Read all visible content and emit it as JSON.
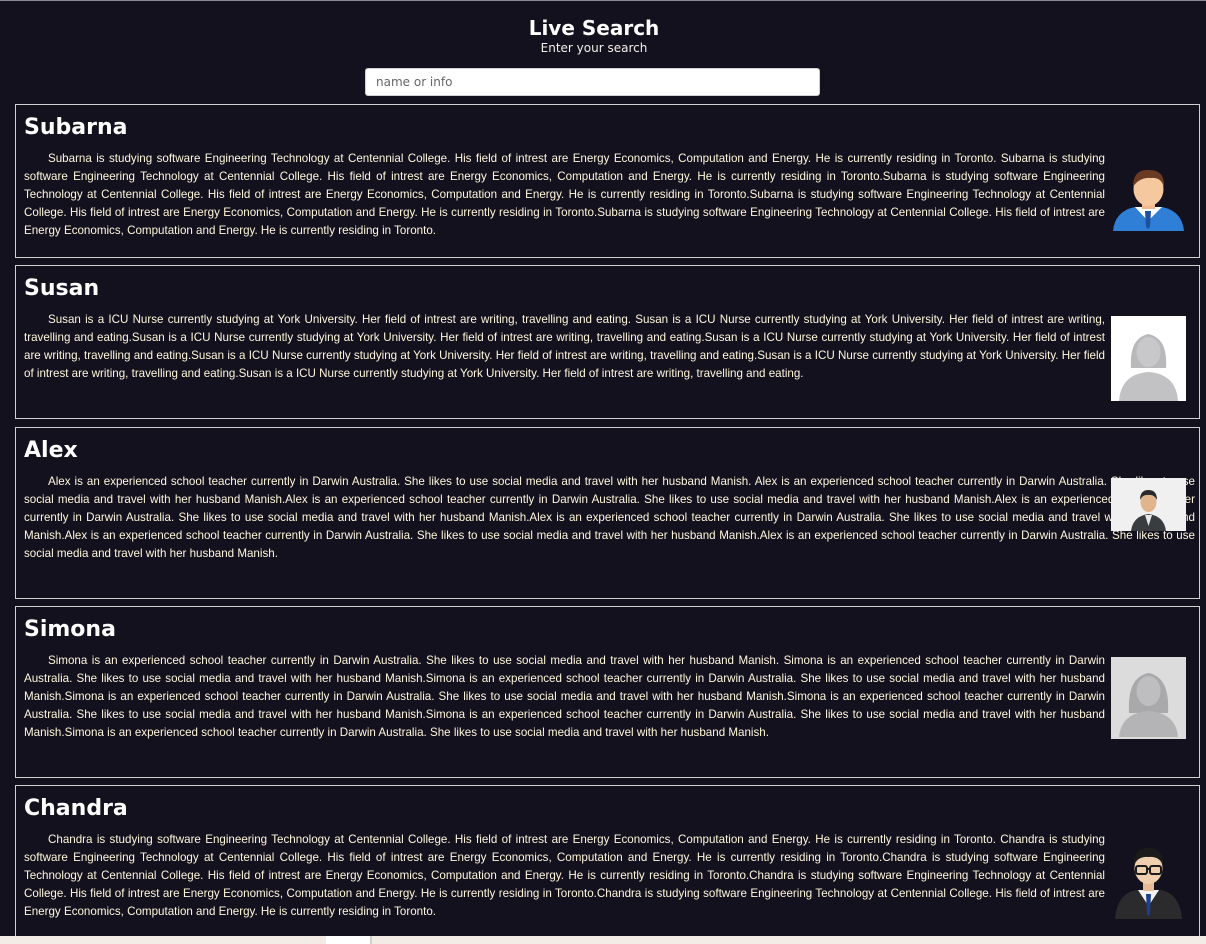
{
  "page": {
    "title": "Live Search",
    "subtitle": "Enter your search"
  },
  "search": {
    "placeholder": "name or info",
    "value": ""
  },
  "profiles": [
    {
      "name": "Subarna",
      "avatar": "male-business-avatar",
      "info": "Subarna is studying software Engineering Technology at Centennial College. His field of intrest are Energy Economics, Computation and Energy. He is currently residing in Toronto. Subarna is studying software Engineering Technology at Centennial College. His field of intrest are Energy Economics, Computation and Energy. He is currently residing in Toronto.Subarna is studying software Engineering Technology at Centennial College. His field of intrest are Energy Economics, Computation and Energy. He is currently residing in Toronto.Subarna is studying software Engineering Technology at Centennial College. His field of intrest are Energy Economics, Computation and Energy. He is currently residing in Toronto.Subarna is studying software Engineering Technology at Centennial College. His field of intrest are Energy Economics, Computation and Energy. He is currently residing in Toronto."
    },
    {
      "name": "Susan",
      "avatar": "female-placeholder-avatar",
      "info": "Susan is a ICU Nurse currently studying at York University. Her field of intrest are writing, travelling and eating. Susan is a ICU Nurse currently studying at York University. Her field of intrest are writing, travelling and eating.Susan is a ICU Nurse currently studying at York University. Her field of intrest are writing, travelling and eating.Susan is a ICU Nurse currently studying at York University. Her field of intrest are writing, travelling and eating.Susan is a ICU Nurse currently studying at York University. Her field of intrest are writing, travelling and eating.Susan is a ICU Nurse currently studying at York University. Her field of intrest are writing, travelling and eating.Susan is a ICU Nurse currently studying at York University. Her field of intrest are writing, travelling and eating."
    },
    {
      "name": "Alex",
      "avatar": "male-suit-avatar",
      "info": "Alex is an experienced school teacher currently in Darwin Australia. She likes to use social media and travel with her husband Manish. Alex is an experienced school teacher currently in Darwin Australia. She likes to use social media and travel with her husband Manish.Alex is an experienced school teacher currently in Darwin Australia. She likes to use social media and travel with her husband Manish.Alex is an experienced school teacher currently in Darwin Australia. She likes to use social media and travel with her husband Manish.Alex is an experienced school teacher currently in Darwin Australia. She likes to use social media and travel with her husband Manish.Alex is an experienced school teacher currently in Darwin Australia. She likes to use social media and travel with her husband Manish.Alex is an experienced school teacher currently in Darwin Australia. She likes to use social media and travel with her husband Manish."
    },
    {
      "name": "Simona",
      "avatar": "female-placeholder-avatar",
      "info": "Simona is an experienced school teacher currently in Darwin Australia. She likes to use social media and travel with her husband Manish. Simona is an experienced school teacher currently in Darwin Australia. She likes to use social media and travel with her husband Manish.Simona is an experienced school teacher currently in Darwin Australia. She likes to use social media and travel with her husband Manish.Simona is an experienced school teacher currently in Darwin Australia. She likes to use social media and travel with her husband Manish.Simona is an experienced school teacher currently in Darwin Australia. She likes to use social media and travel with her husband Manish.Simona is an experienced school teacher currently in Darwin Australia. She likes to use social media and travel with her husband Manish.Simona is an experienced school teacher currently in Darwin Australia. She likes to use social media and travel with her husband Manish."
    },
    {
      "name": "Chandra",
      "avatar": "male-glasses-avatar",
      "info": "Chandra is studying software Engineering Technology at Centennial College. His field of intrest are Energy Economics, Computation and Energy. He is currently residing in Toronto. Chandra is studying software Engineering Technology at Centennial College. His field of intrest are Energy Economics, Computation and Energy. He is currently residing in Toronto.Chandra is studying software Engineering Technology at Centennial College. His field of intrest are Energy Economics, Computation and Energy. He is currently residing in Toronto.Chandra is studying software Engineering Technology at Centennial College. His field of intrest are Energy Economics, Computation and Energy. He is currently residing in Toronto.Chandra is studying software Engineering Technology at Centennial College. His field of intrest are Energy Economics, Computation and Energy. He is currently residing in Toronto."
    }
  ]
}
